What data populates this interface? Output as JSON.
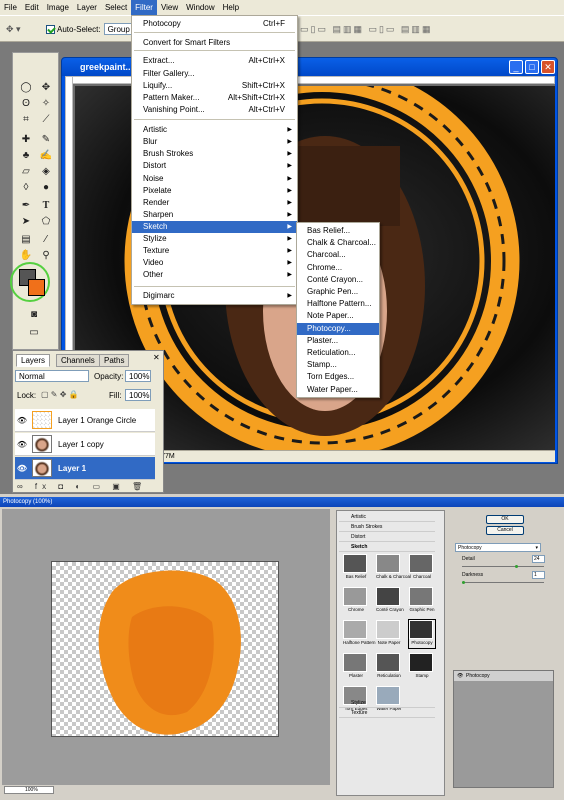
{
  "menubar": {
    "items": [
      "File",
      "Edit",
      "Image",
      "Layer",
      "Select",
      "Filter",
      "View",
      "Window",
      "Help"
    ]
  },
  "options": {
    "auto_select_label": "Auto-Select:",
    "auto_select_value": "Group"
  },
  "document": {
    "title": "greekpaint...",
    "status": "52.1K/4.77M"
  },
  "filter_menu": {
    "items": [
      {
        "label": "Photocopy",
        "shortcut": "Ctrl+F"
      },
      {
        "label": "Convert for Smart Filters",
        "shortcut": ""
      },
      {
        "label": "Extract...",
        "shortcut": "Alt+Ctrl+X"
      },
      {
        "label": "Filter Gallery...",
        "shortcut": ""
      },
      {
        "label": "Liquify...",
        "shortcut": "Shift+Ctrl+X"
      },
      {
        "label": "Pattern Maker...",
        "shortcut": "Alt+Shift+Ctrl+X"
      },
      {
        "label": "Vanishing Point...",
        "shortcut": "Alt+Ctrl+V"
      },
      {
        "label": "Artistic",
        "shortcut": ""
      },
      {
        "label": "Blur",
        "shortcut": ""
      },
      {
        "label": "Brush Strokes",
        "shortcut": ""
      },
      {
        "label": "Distort",
        "shortcut": ""
      },
      {
        "label": "Noise",
        "shortcut": ""
      },
      {
        "label": "Pixelate",
        "shortcut": ""
      },
      {
        "label": "Render",
        "shortcut": ""
      },
      {
        "label": "Sharpen",
        "shortcut": ""
      },
      {
        "label": "Sketch",
        "shortcut": ""
      },
      {
        "label": "Stylize",
        "shortcut": ""
      },
      {
        "label": "Texture",
        "shortcut": ""
      },
      {
        "label": "Video",
        "shortcut": ""
      },
      {
        "label": "Other",
        "shortcut": ""
      },
      {
        "label": "Digimarc",
        "shortcut": ""
      }
    ]
  },
  "sketch_menu": {
    "items": [
      "Bas Relief...",
      "Chalk & Charcoal...",
      "Charcoal...",
      "Chrome...",
      "Conté Crayon...",
      "Graphic Pen...",
      "Halftone Pattern...",
      "Note Paper...",
      "Photocopy...",
      "Plaster...",
      "Reticulation...",
      "Stamp...",
      "Torn Edges...",
      "Water Paper..."
    ]
  },
  "layers_panel": {
    "tabs": [
      "Layers",
      "Channels",
      "Paths"
    ],
    "blend_mode": "Normal",
    "opacity_label": "Opacity:",
    "opacity": "100%",
    "lock_label": "Lock:",
    "fill_label": "Fill:",
    "fill": "100%",
    "layers": [
      "Layer 1 Orange Circle",
      "Layer 1 copy",
      "Layer 1"
    ]
  },
  "dialog": {
    "title": "Photocopy (100%)",
    "zoom": "100%",
    "folders": [
      "Artistic",
      "Brush Strokes",
      "Distort",
      "Sketch"
    ],
    "folders_bottom": [
      "Stylize",
      "Texture"
    ],
    "thumbs": [
      "Bas Relief",
      "Chalk & Charcoal",
      "Charcoal",
      "Chrome",
      "Conté Crayon",
      "Graphic Pen",
      "Halftone Pattern",
      "Note Paper",
      "Photocopy",
      "Plaster",
      "Reticulation",
      "Stamp",
      "Torn Edges",
      "Water Paper"
    ],
    "ok": "OK",
    "cancel": "Cancel",
    "filter_select": "Photocopy",
    "detail_label": "Detail",
    "detail_value": "24",
    "darkness_label": "Darkness",
    "darkness_value": "1",
    "effect_layer": "Photocopy"
  },
  "colors": {
    "orange": "#f5a020",
    "accent": "#316ac5"
  }
}
